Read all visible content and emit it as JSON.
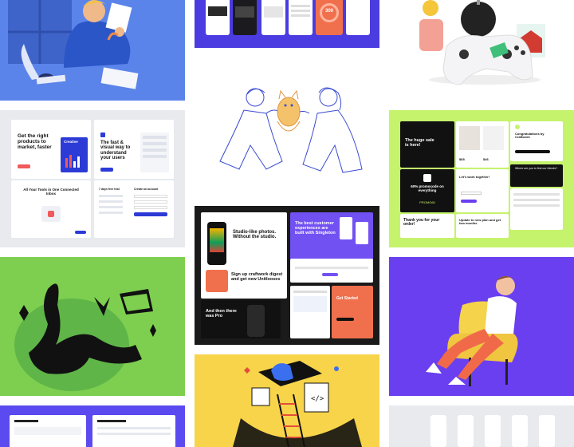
{
  "colors": {
    "blue": "#5b84ea",
    "indigo": "#4a3ce0",
    "lime": "#c5f36c",
    "green": "#7ecf4f",
    "violet": "#6a3ff0",
    "yellow": "#f7d44a",
    "grey": "#e8eaee",
    "black": "#111111",
    "orange": "#f0704d",
    "purple": "#7251f2"
  },
  "tiles": {
    "app_screens": {
      "metric": "300"
    },
    "landing_pages": {
      "headline_left": "Get the right products to market, faster",
      "creative_word": "Creative",
      "headline_right": "The fast & visual way to understand your users",
      "tools_title": "All Your Tools in One Connected Inbox",
      "signup_title": "Create an account",
      "steps_title": "7 days free trial"
    },
    "ecommerce": {
      "hero": "The huge sale is here!",
      "promo": "60% promocode on everything",
      "promo_code": "PROMO60",
      "wallet": "Let's work together!",
      "thanks": "Thank you for your order!",
      "update": "Update to new plan and get two months",
      "congrats": "Congratulations by Craftwork",
      "newsletter": "Where are you to find our friends?",
      "item1_price": "$68",
      "item2_price": "$46"
    },
    "craftwork": {
      "studio": "Studio-like photos. Without the studio.",
      "experiences": "The best customer experiences are built with Singleton",
      "signup": "Sign up craftwork digest and get new Unitlooses",
      "then": "And then there was Pro",
      "started": "Get Started"
    }
  }
}
